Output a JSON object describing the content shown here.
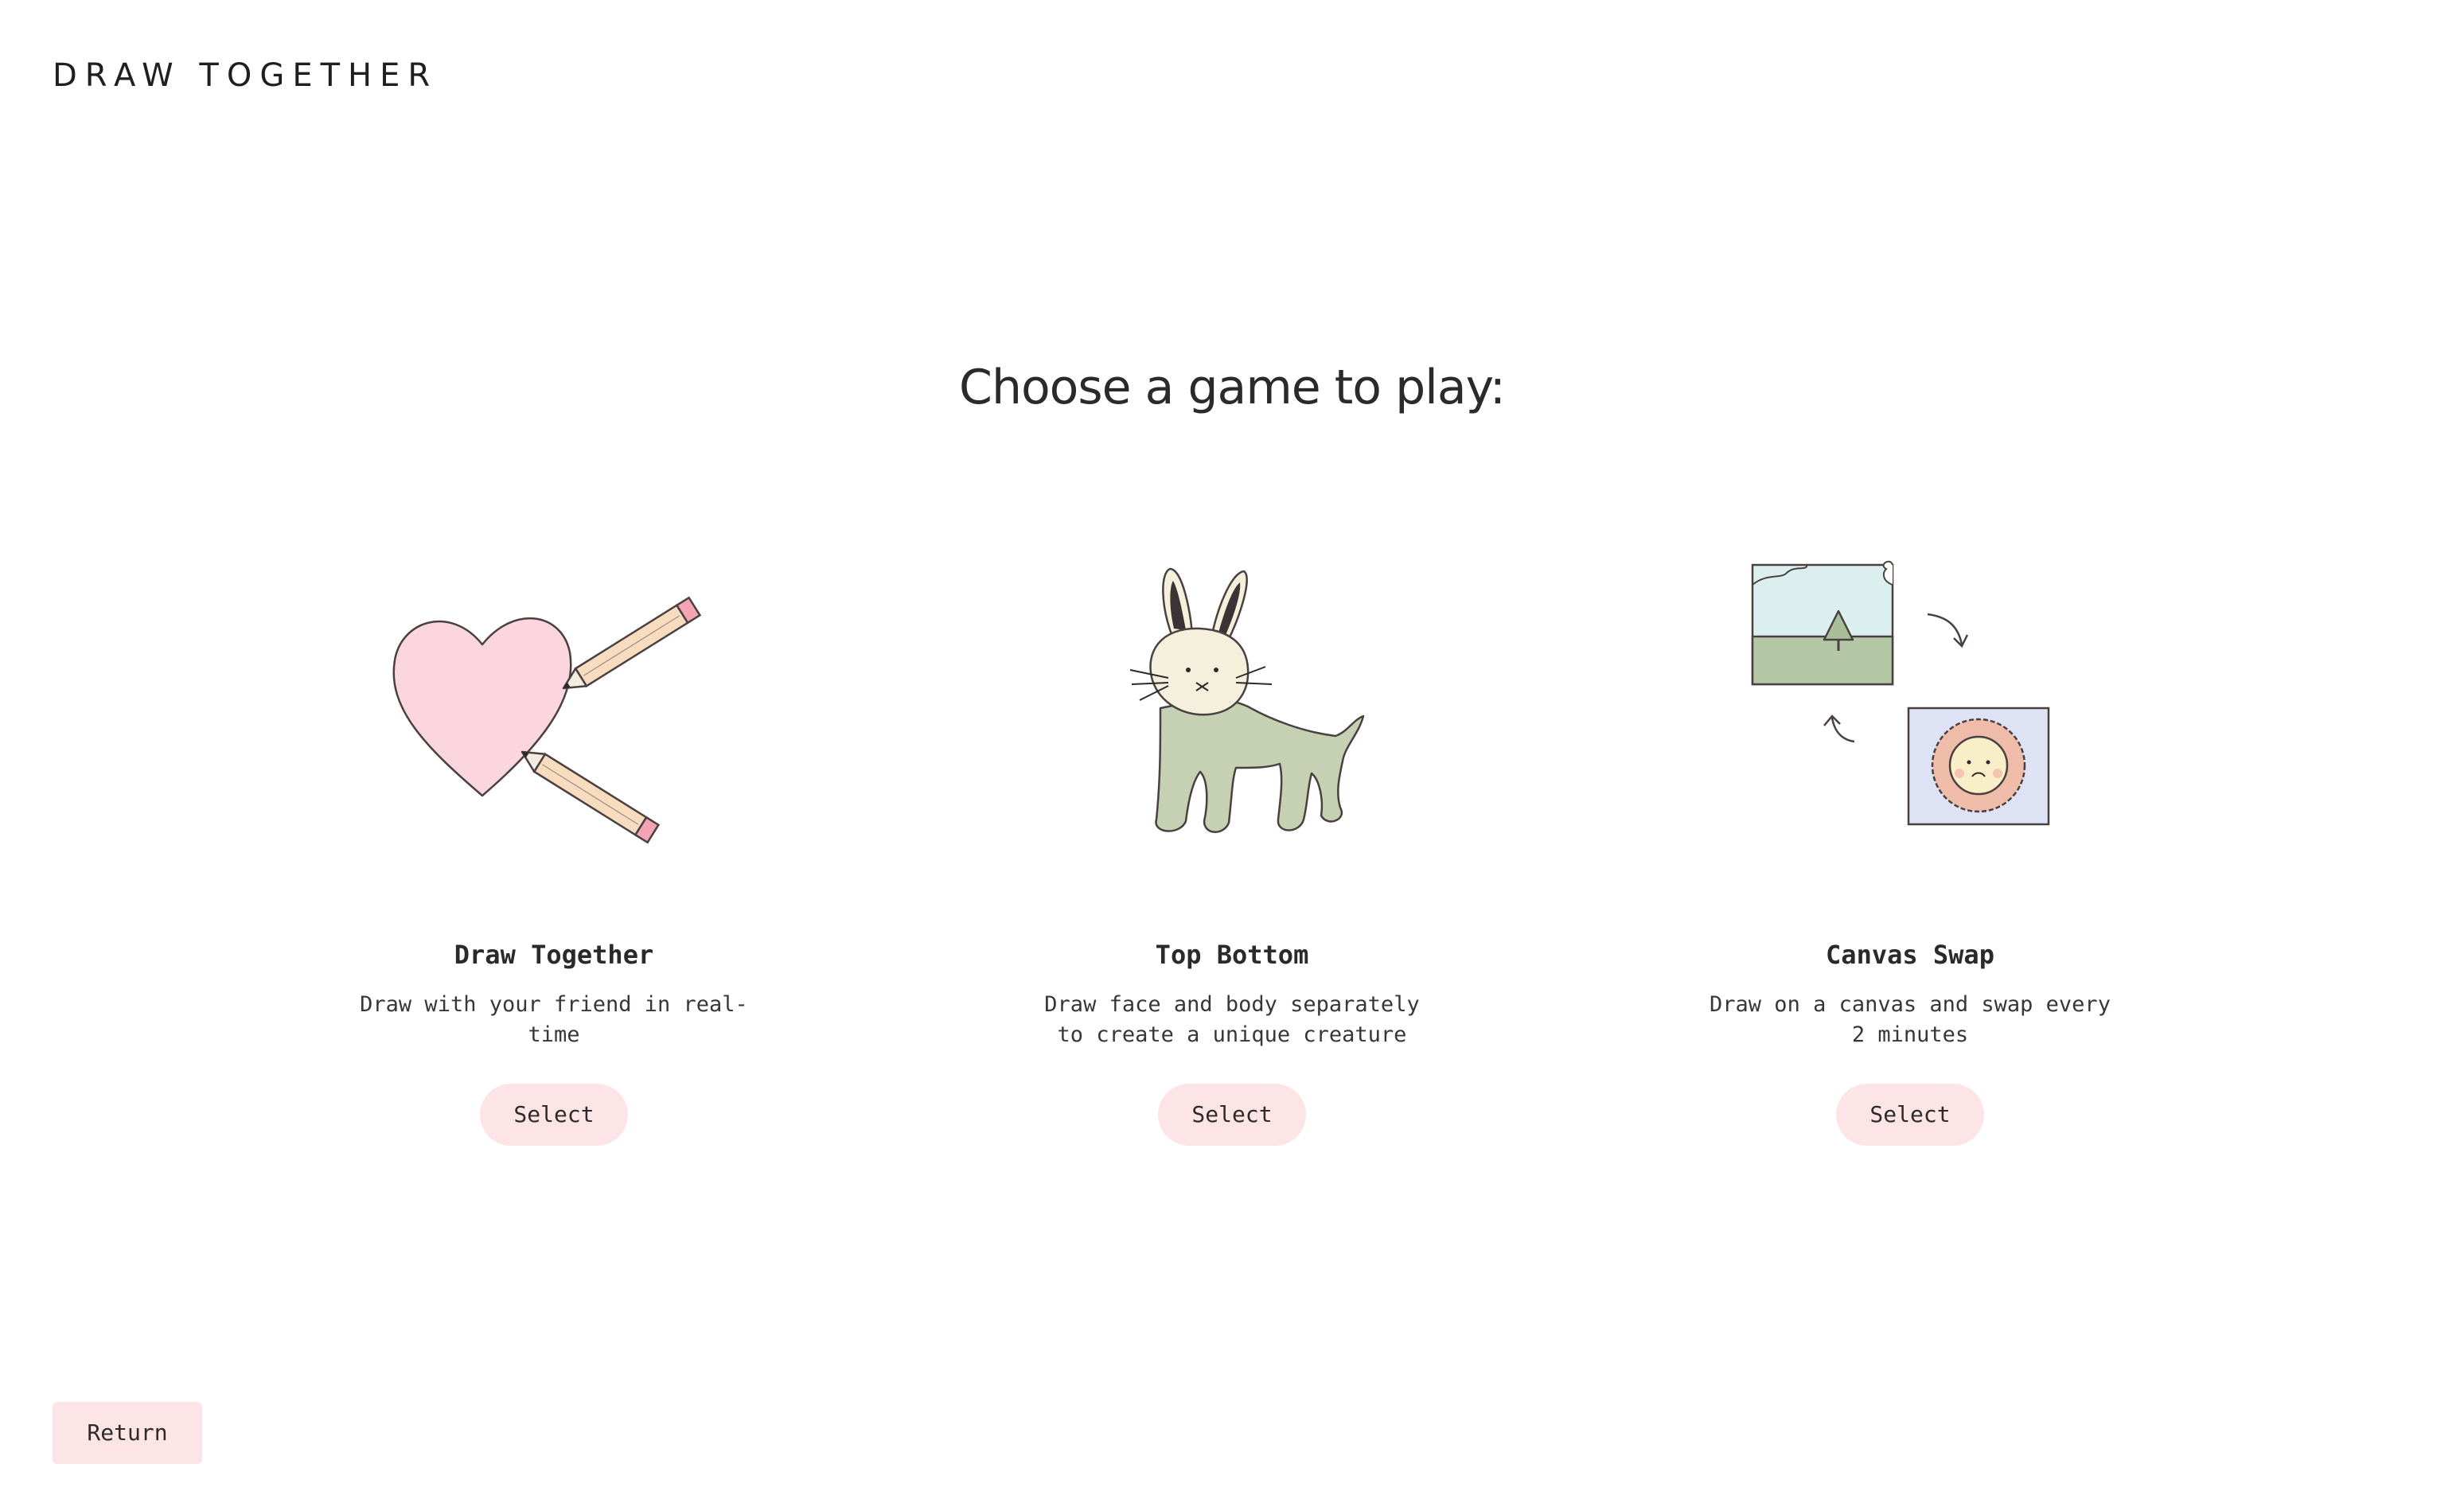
{
  "header": {
    "logo_text": "DRAW TOGETHER"
  },
  "main": {
    "title": "Choose a game to play:",
    "games": [
      {
        "name": "Draw Together",
        "description": "Draw with your friend in real-time",
        "select_label": "Select",
        "icon": "heart-with-pencils-icon"
      },
      {
        "name": "Top Bottom",
        "description": "Draw face and body separately to create a unique creature",
        "select_label": "Select",
        "icon": "bunny-creature-icon"
      },
      {
        "name": "Canvas Swap",
        "description": "Draw on a canvas and swap every 2 minutes",
        "select_label": "Select",
        "icon": "canvas-swap-icon"
      }
    ]
  },
  "footer": {
    "return_label": "Return"
  },
  "colors": {
    "button_bg": "#fde4e7",
    "text": "#2e2a2a"
  }
}
